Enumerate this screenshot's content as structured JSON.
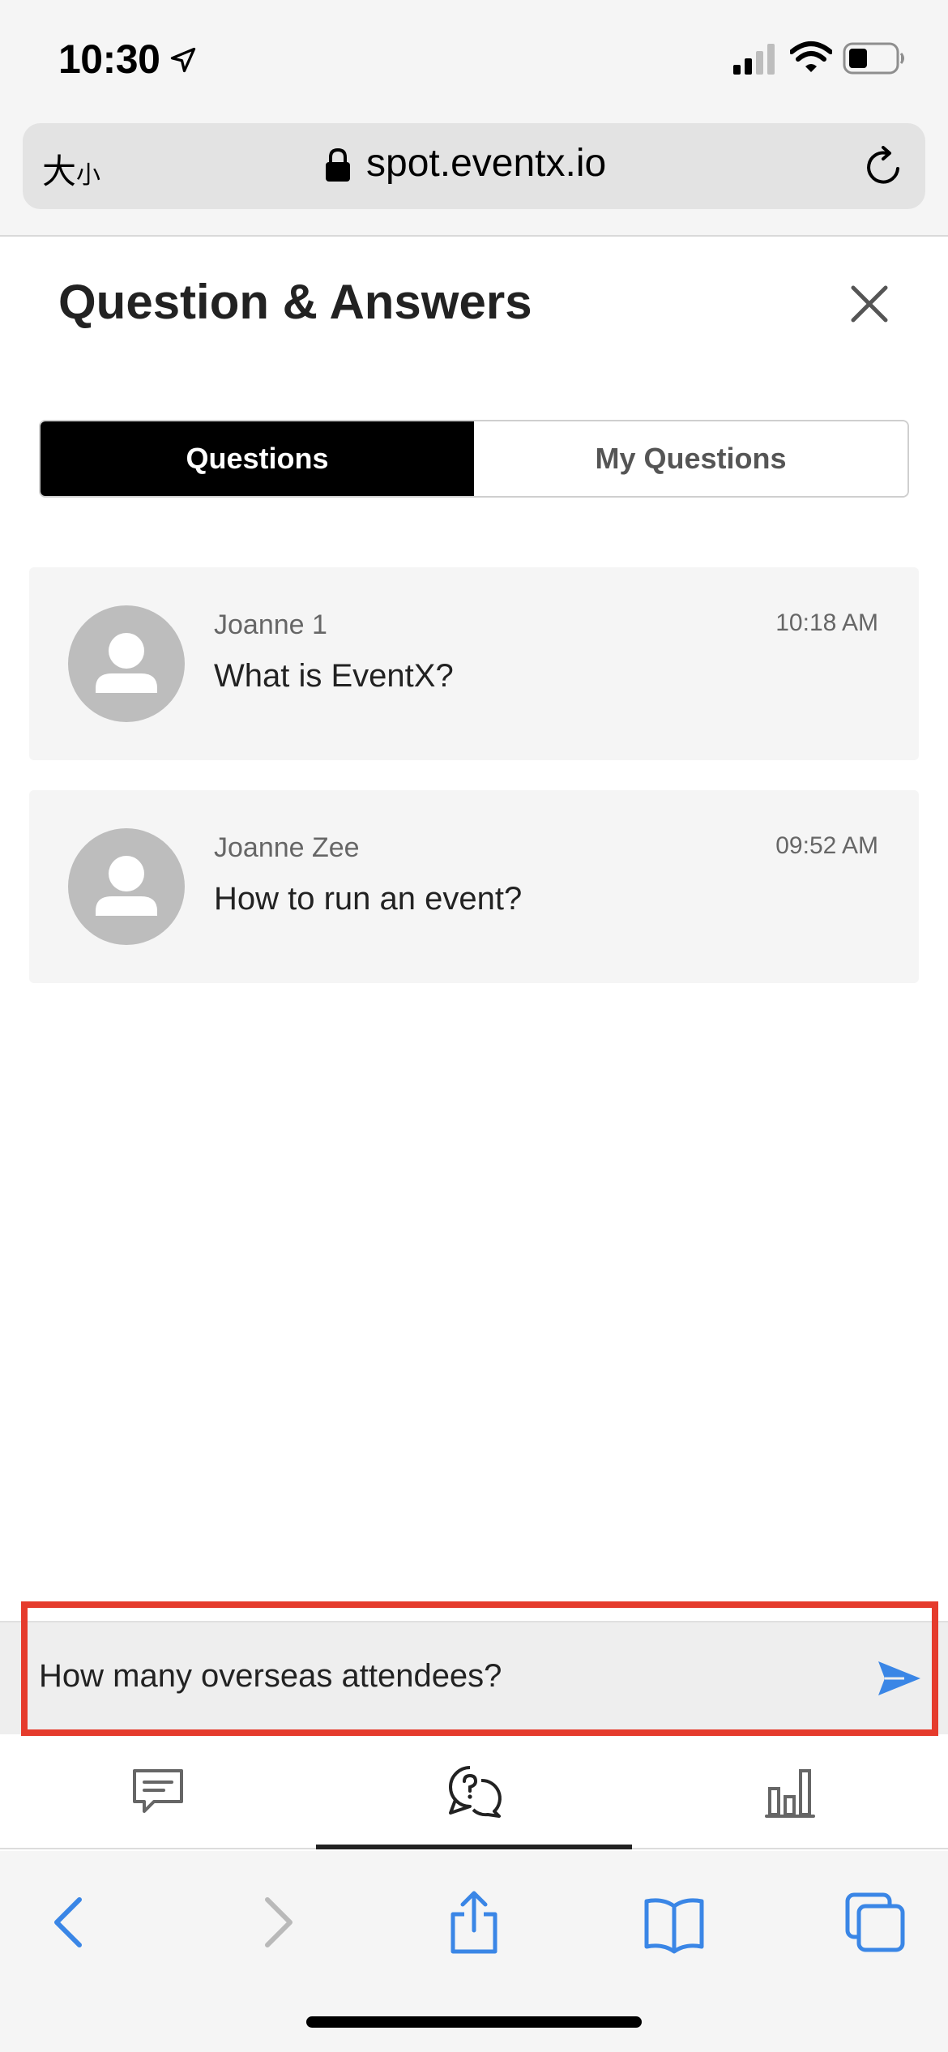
{
  "status_bar": {
    "time": "10:30"
  },
  "browser": {
    "text_size_label_big": "大",
    "text_size_label_small": "小",
    "url": "spot.eventx.io"
  },
  "page": {
    "title": "Question & Answers"
  },
  "tabs": [
    {
      "label": "Questions",
      "active": true
    },
    {
      "label": "My Questions",
      "active": false
    }
  ],
  "questions": [
    {
      "author": "Joanne 1",
      "time": "10:18 AM",
      "text": "What is EventX?"
    },
    {
      "author": "Joanne Zee",
      "time": "09:52 AM",
      "text": "How to run an event?"
    }
  ],
  "composer": {
    "value": "How many overseas attendees?"
  },
  "app_tabs": [
    {
      "icon": "chat-icon",
      "active": false
    },
    {
      "icon": "qa-icon",
      "active": true
    },
    {
      "icon": "poll-chart-icon",
      "active": false
    }
  ],
  "colors": {
    "accent_blue": "#3a86e6",
    "active_tab_bg": "#000000",
    "highlight_red": "#e53b2c",
    "card_bg": "#f5f5f5"
  }
}
